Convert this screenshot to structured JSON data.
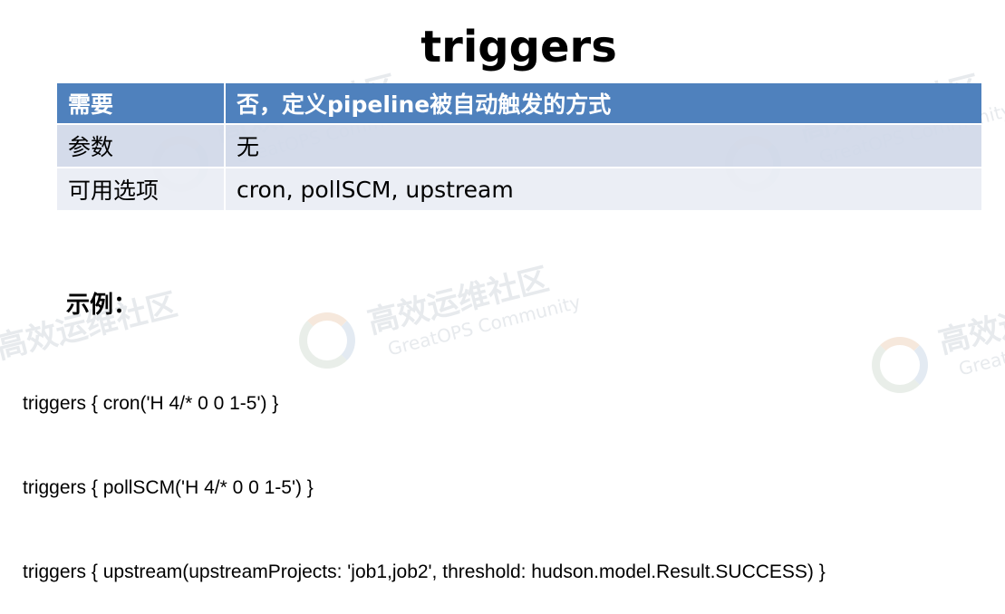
{
  "title": "triggers",
  "table": {
    "rows": [
      {
        "key": "需要",
        "value": "否，定义pipeline被自动触发的方式"
      },
      {
        "key": "参数",
        "value": "无"
      },
      {
        "key": "可用选项",
        "value": "cron, pollSCM, upstream"
      }
    ]
  },
  "example": {
    "label": "示例：",
    "lines": [
      "triggers { cron('H 4/* 0 0 1-5') }",
      "triggers { pollSCM('H 4/* 0 0 1-5') }",
      "triggers { upstream(upstreamProjects: 'job1,job2', threshold: hudson.model.Result.SUCCESS) }"
    ]
  },
  "watermark": {
    "cn": "高效运维社区",
    "en": "GreatOPS Community"
  },
  "colors": {
    "header_bg": "#4f81bd",
    "row_odd_bg": "#d0d8e8",
    "row_even_bg": "#e9edf4"
  }
}
